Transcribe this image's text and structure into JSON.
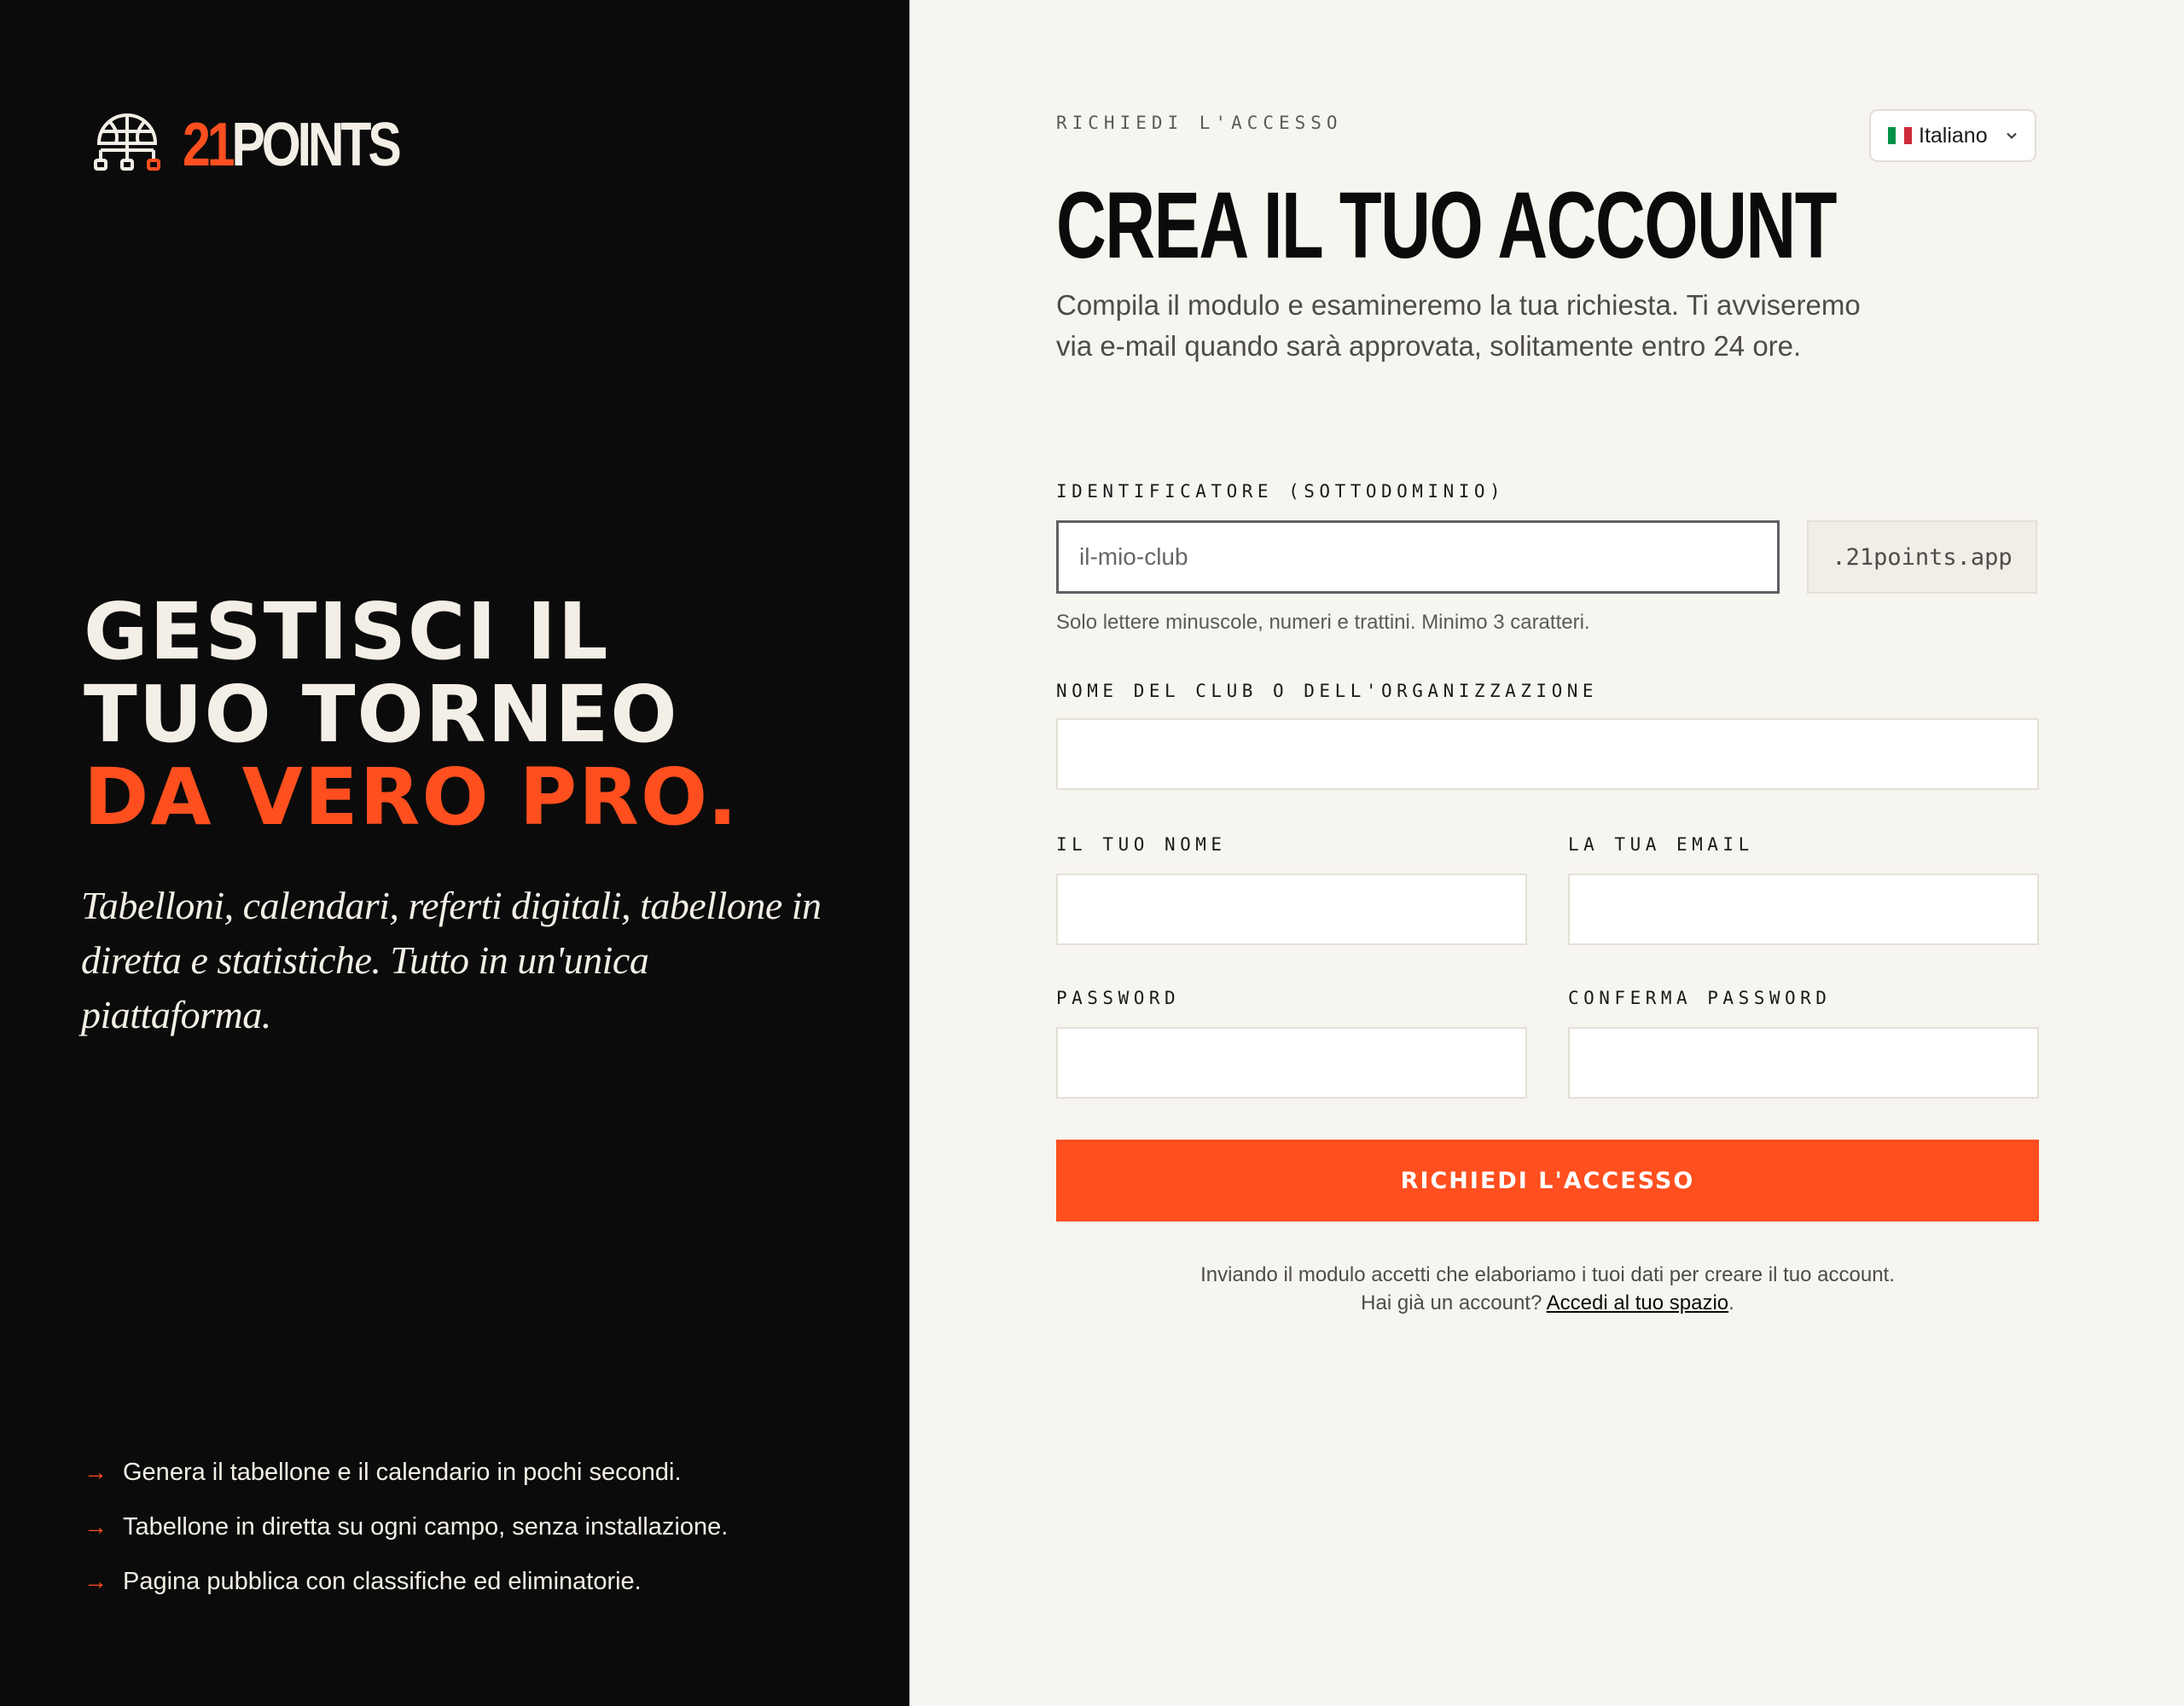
{
  "brand": {
    "logo_number": "21",
    "logo_word": "POINTS",
    "icon": "basketball-bracket-icon"
  },
  "hero": {
    "line1": "GESTISCI IL",
    "line2": "TUO TORNEO",
    "line3": "DA VERO PRO.",
    "tagline": "Tabelloni, calendari, referti digitali, tabellone in diretta e statistiche. Tutto in un'unica piattaforma."
  },
  "features": [
    {
      "arrow": "→",
      "text": "Genera il tabellone e il calendario in pochi secondi."
    },
    {
      "arrow": "→",
      "text": "Tabellone in diretta su ogni campo, senza installazione."
    },
    {
      "arrow": "→",
      "text": "Pagina pubblica con classifiche ed eliminatorie."
    }
  ],
  "header": {
    "eyebrow": "RICHIEDI L'ACCESSO",
    "language": "Italiano",
    "flag_colors": [
      "#009246",
      "#ffffff",
      "#ce2b37"
    ]
  },
  "form": {
    "title": "CREA IL TUO ACCOUNT",
    "description": "Compila il modulo e esamineremo la tua richiesta. Ti avviseremo via e-mail quando sarà approvata, solitamente entro 24 ore.",
    "subdomain": {
      "label": "IDENTIFICATORE (SOTTODOMINIO)",
      "placeholder": "il-mio-club",
      "value": "",
      "suffix": ".21points.app",
      "hint": "Solo lettere minuscole, numeri e trattini. Minimo 3 caratteri."
    },
    "club": {
      "label": "NOME DEL CLUB O DELL'ORGANIZZAZIONE",
      "value": ""
    },
    "name": {
      "label": "IL TUO NOME",
      "value": ""
    },
    "email": {
      "label": "LA TUA EMAIL",
      "value": ""
    },
    "password": {
      "label": "PASSWORD",
      "value": ""
    },
    "confirm": {
      "label": "CONFERMA PASSWORD",
      "value": ""
    },
    "submit": "RICHIEDI L'ACCESSO",
    "legal_line1": "Inviando il modulo accetti che elaboriamo i tuoi dati per creare il tuo account.",
    "legal_prefix": "Hai già un account?",
    "legal_link": "Accedi al tuo spazio",
    "legal_suffix": "."
  },
  "colors": {
    "accent": "#ff4f1f",
    "dark": "#0b0b0b",
    "light": "#f7f5f0"
  }
}
